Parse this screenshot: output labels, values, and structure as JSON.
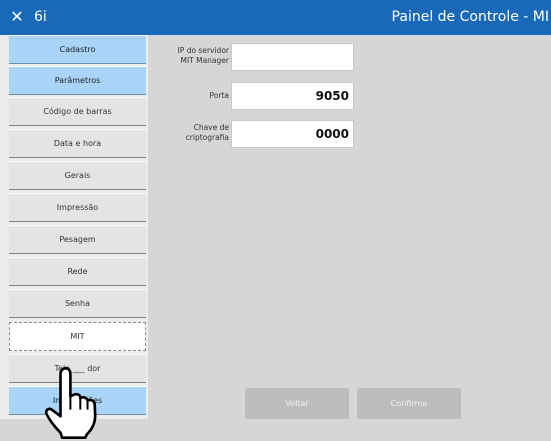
{
  "titlebar": {
    "close_icon": "close-icon",
    "app_id": "6i",
    "title": "Painel de Controle - MI"
  },
  "sidebar": {
    "items": [
      {
        "label": "Cadastro",
        "style": "blue"
      },
      {
        "label": "Parâmetros",
        "style": "blue"
      },
      {
        "label": "Código de barras",
        "style": "gray"
      },
      {
        "label": "Data e hora",
        "style": "gray"
      },
      {
        "label": "Gerais",
        "style": "gray"
      },
      {
        "label": "Impressão",
        "style": "gray"
      },
      {
        "label": "Pesagem",
        "style": "gray"
      },
      {
        "label": "Rede",
        "style": "gray"
      },
      {
        "label": "Senha",
        "style": "gray"
      },
      {
        "label": "MIT",
        "style": "selected"
      },
      {
        "label": "Tela ___ dor",
        "style": "gray"
      },
      {
        "label": "Informações",
        "style": "blue"
      }
    ]
  },
  "form": {
    "server_label": "IP do servidor\nMIT Manager",
    "server_value": "",
    "port_label": "Porta",
    "port_value": "9050",
    "key_label": "Chave de\ncriptografia",
    "key_value": "0000"
  },
  "buttons": {
    "back": "Voltar",
    "confirm": "Confirma"
  },
  "colors": {
    "titlebar": "#1a68b8",
    "blue_item": "#a9d3f7",
    "gray_item": "#e4e4e4",
    "content_bg": "#d6d6d6",
    "button_disabled": "#bdbdbd"
  },
  "cursor_icon": "hand-pointer-icon"
}
